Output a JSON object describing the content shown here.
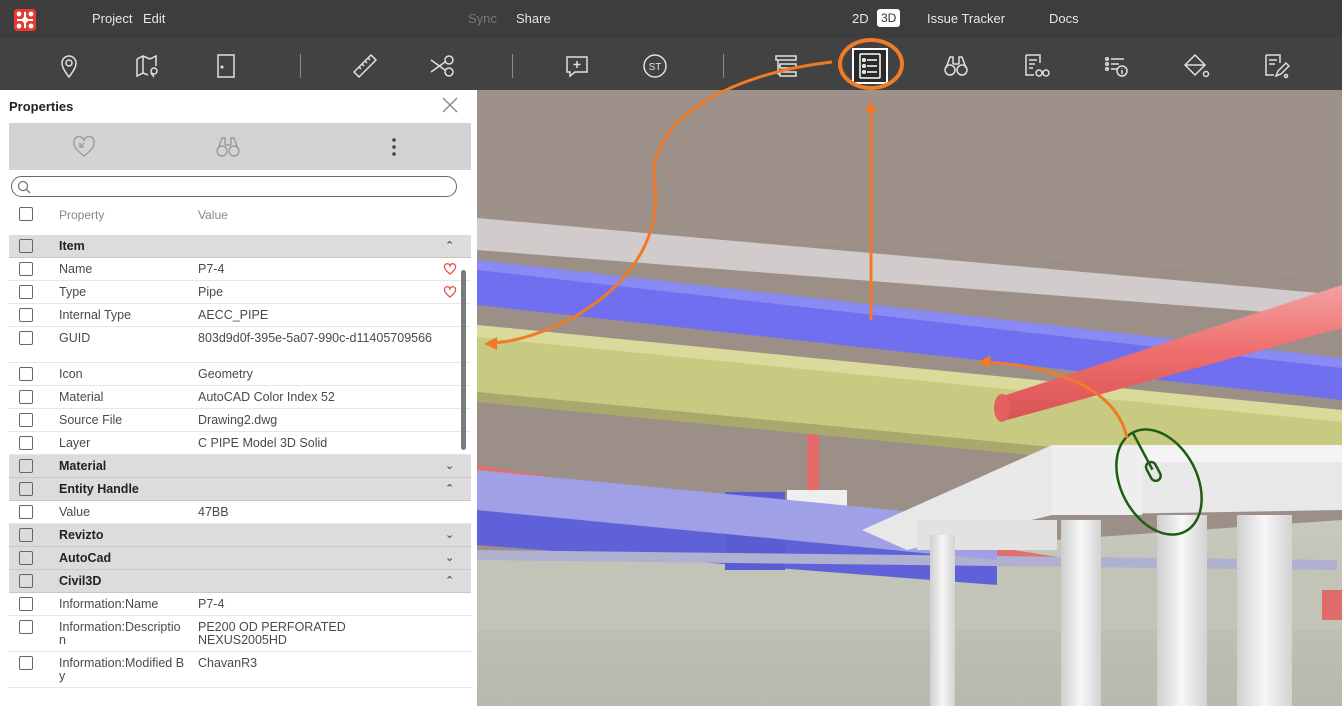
{
  "menubar": {
    "project": "Project",
    "edit": "Edit",
    "sync": "Sync",
    "share": "Share",
    "view_2d": "2D",
    "view_3d": "3D",
    "issue_tracker": "Issue Tracker",
    "docs": "Docs"
  },
  "toolbar": {
    "icons": [
      "pin-icon",
      "map-pin-icon",
      "door-icon",
      "ruler-icon",
      "scissors-icon",
      "add-comment-icon",
      "standard-st-icon",
      "layers-icon",
      "properties-list-icon",
      "binoculars-icon",
      "search-sets-icon",
      "info-list-icon",
      "paint-bucket-icon",
      "markup-pen-icon"
    ],
    "st_label": "ST",
    "highlight_color": "#ee7a2a"
  },
  "panel": {
    "title": "Properties",
    "search_placeholder": "",
    "column_property": "Property",
    "column_value": "Value",
    "rows": [
      {
        "type": "group",
        "label": "Item",
        "expanded": true
      },
      {
        "type": "prop",
        "property": "Name",
        "value": "P7-4",
        "favorite": true
      },
      {
        "type": "prop",
        "property": "Type",
        "value": "Pipe",
        "favorite": true
      },
      {
        "type": "prop",
        "property": "Internal Type",
        "value": "AECC_PIPE"
      },
      {
        "type": "prop",
        "property": "GUID",
        "value": "803d9d0f-395e-5a07-990c-d11405709566"
      },
      {
        "type": "prop",
        "property": "Icon",
        "value": "Geometry"
      },
      {
        "type": "prop",
        "property": "Material",
        "value": "AutoCAD Color Index 52"
      },
      {
        "type": "prop",
        "property": "Source File",
        "value": "Drawing2.dwg"
      },
      {
        "type": "prop",
        "property": "Layer",
        "value": "C PIPE Model 3D Solid"
      },
      {
        "type": "group",
        "label": "Material",
        "expanded": false
      },
      {
        "type": "group",
        "label": "Entity Handle",
        "expanded": true
      },
      {
        "type": "prop",
        "property": "Value",
        "value": "47BB"
      },
      {
        "type": "group",
        "label": "Revizto",
        "expanded": false
      },
      {
        "type": "group",
        "label": "AutoCad",
        "expanded": false
      },
      {
        "type": "group",
        "label": "Civil3D",
        "expanded": true
      },
      {
        "type": "prop",
        "property": "Information:Name",
        "value": "P7-4"
      },
      {
        "type": "prop",
        "property": "Information:Description",
        "value": "PE200 OD PERFORATED NEXUS2005HD"
      },
      {
        "type": "prop",
        "property": "Information:Modified By",
        "value": "ChavanR3"
      }
    ]
  },
  "colors": {
    "accent_orange": "#ee7a2a",
    "pipe_blue": "#6f6ff0",
    "pipe_red": "#f07070",
    "beam_yellow": "#c8c980",
    "mouse_outline": "#1e5c12"
  }
}
